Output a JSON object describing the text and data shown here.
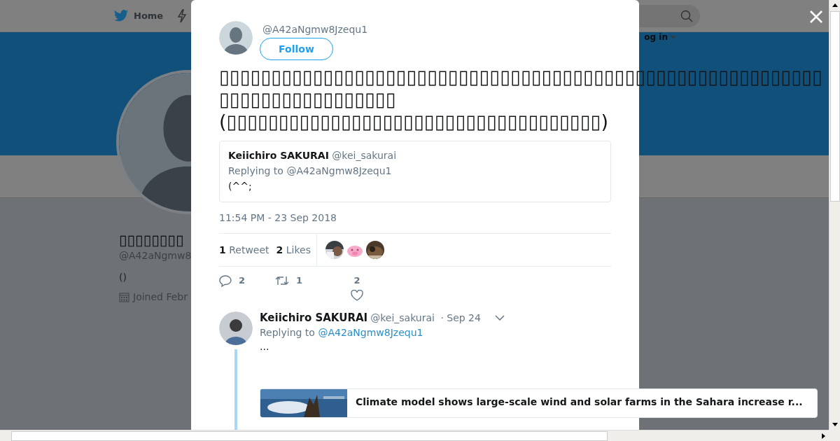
{
  "nav": {
    "home": "Home",
    "login": "og in"
  },
  "profile": {
    "name": "▯▯▯▯▯▯▯▯",
    "handle": "@A42aNgmw8",
    "bio": "()",
    "joined": "Joined Febr"
  },
  "tweet": {
    "handle": "@A42aNgmw8Jzequ1",
    "follow": "Follow",
    "text_lines": [
      "▯▯▯▯▯▯▯▯▯▯▯▯▯▯▯▯▯▯▯▯▯▯▯▯▯▯▯▯▯▯▯▯▯▯▯▯▯▯▯▯▯▯▯▯▯▯▯▯▯▯▯▯▯▯▯▯▯▯",
      "▯▯▯▯▯▯▯▯▯▯▯▯▯▯▯▯▯",
      "(▯▯▯▯▯▯▯▯▯▯▯▯▯▯▯▯▯▯▯▯▯▯▯▯▯▯▯▯▯▯▯▯▯▯▯▯)"
    ],
    "quote": {
      "name": "Keiichiro SAKURAI",
      "handle": "@kei_sakurai",
      "replying": "Replying to @A42aNgmw8Jzequ1",
      "text": "(^^;"
    },
    "timestamp": "11:54 PM - 23 Sep 2018",
    "retweets": "**1** Retweet",
    "likes": "**2** Likes",
    "actions": {
      "replies": "2",
      "retweets": "1",
      "likes": "2"
    }
  },
  "reply": {
    "name": "Keiichiro SAKURAI",
    "handle": "@kei_sakurai",
    "time": "· Sep 24",
    "replying_prefix": "Replying to",
    "replying_handle": "@A42aNgmw8Jzequ1",
    "text": "...",
    "card_title": "Climate model shows large-scale wind and solar farms in the Sahara increase r..."
  }
}
